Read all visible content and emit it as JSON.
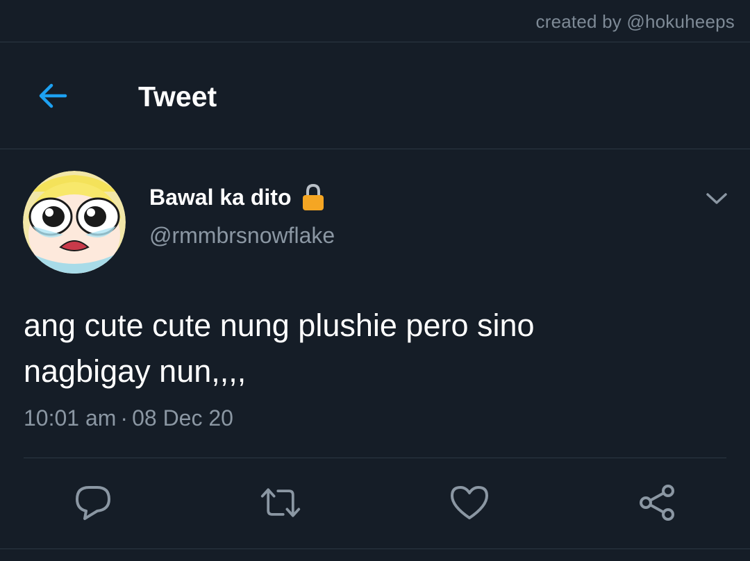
{
  "credit": "created by @hokuheeps",
  "header": {
    "title": "Tweet",
    "back_icon": "arrow-left-icon"
  },
  "tweet": {
    "display_name": "Bawal ka dito",
    "handle": "@rmmbrsnowflake",
    "text_line1": "ang cute cute nung plushie pero sino",
    "text_line2": "nagbigay nun,,,,",
    "time": "10:01 am",
    "separator": "·",
    "date": "08 Dec 20",
    "protected_icon": "lock-icon",
    "menu_icon": "chevron-down-icon"
  },
  "actions": {
    "reply_icon": "reply-icon",
    "retweet_icon": "retweet-icon",
    "like_icon": "heart-icon",
    "share_icon": "share-icon"
  },
  "colors": {
    "background": "#151d27",
    "accent": "#1da1f2",
    "text_primary": "#ffffff",
    "text_secondary": "#8b97a3",
    "border": "#2c3843",
    "icon": "#8b97a3",
    "lock": "#f5a623"
  }
}
